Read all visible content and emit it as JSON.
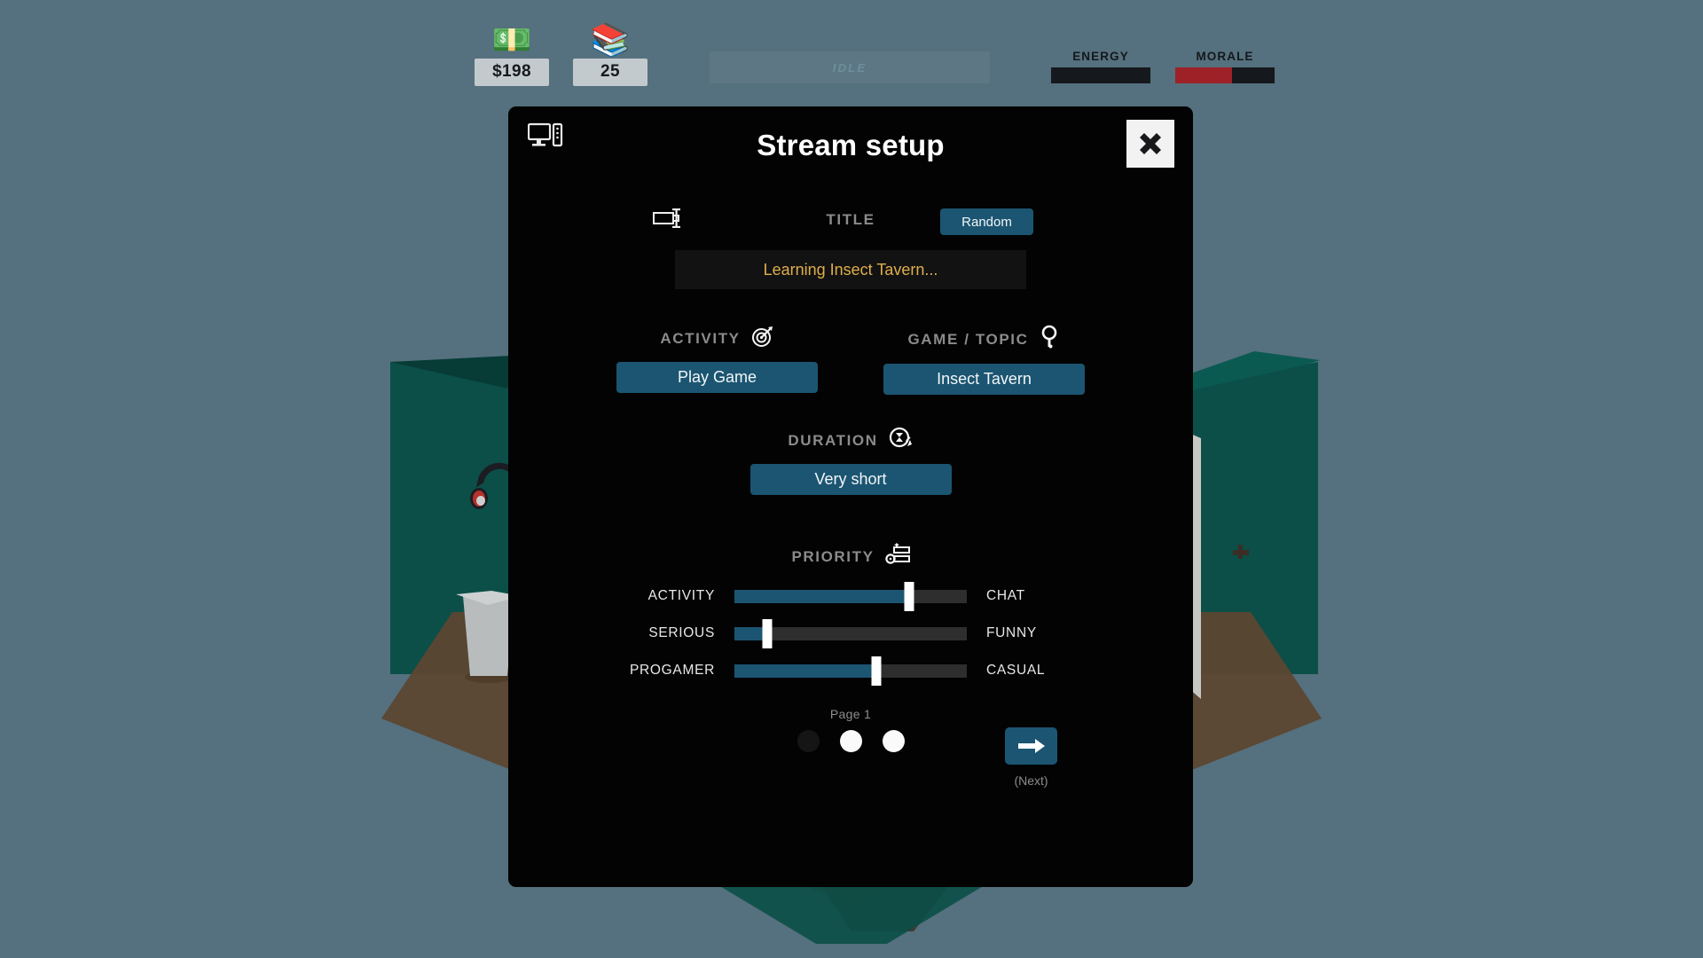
{
  "hud": {
    "money": {
      "icon": "money-icon",
      "glyph": "💵",
      "value": "$198"
    },
    "books": {
      "icon": "books-icon",
      "glyph": "📚",
      "value": "25"
    },
    "status": "IDLE",
    "meters": [
      {
        "label": "ENERGY",
        "percent": 0,
        "color": "#15191d"
      },
      {
        "label": "MORALE",
        "percent": 57,
        "color": "#9e2128"
      }
    ]
  },
  "modal": {
    "window_icon": "desktop-computer-icon",
    "title": "Stream setup",
    "close_label": "",
    "title_section": {
      "icon": "nametag-icon",
      "label": "TITLE",
      "random_label": "Random",
      "value": "Learning Insect Tavern..."
    },
    "activity": {
      "icon": "dartboard-target-icon",
      "label": "ACTIVITY",
      "value": "Play Game"
    },
    "game_topic": {
      "icon": "magnifying-glass-icon",
      "label": "GAME / TOPIC",
      "value": "Insect Tavern"
    },
    "duration": {
      "icon": "hourglass-reset-icon",
      "label": "DURATION",
      "value": "Very short"
    },
    "priority": {
      "icon": "sliders-gear-icon",
      "label": "PRIORITY",
      "sliders": [
        {
          "left": "ACTIVITY",
          "right": "CHAT",
          "percent": 75
        },
        {
          "left": "SERIOUS",
          "right": "FUNNY",
          "percent": 14
        },
        {
          "left": "PROGAMER",
          "right": "CASUAL",
          "percent": 61
        }
      ]
    },
    "pager": {
      "page_label": "Page 1",
      "dots": [
        "off",
        "on",
        "on"
      ],
      "next_icon": "arrow-right-icon",
      "next_label": "(Next)"
    }
  },
  "colors": {
    "background": "#55707e",
    "accent_blue": "#1b5572",
    "title_text": "#dfae4b",
    "morale": "#9e2128",
    "wall": "#0b4f48"
  }
}
